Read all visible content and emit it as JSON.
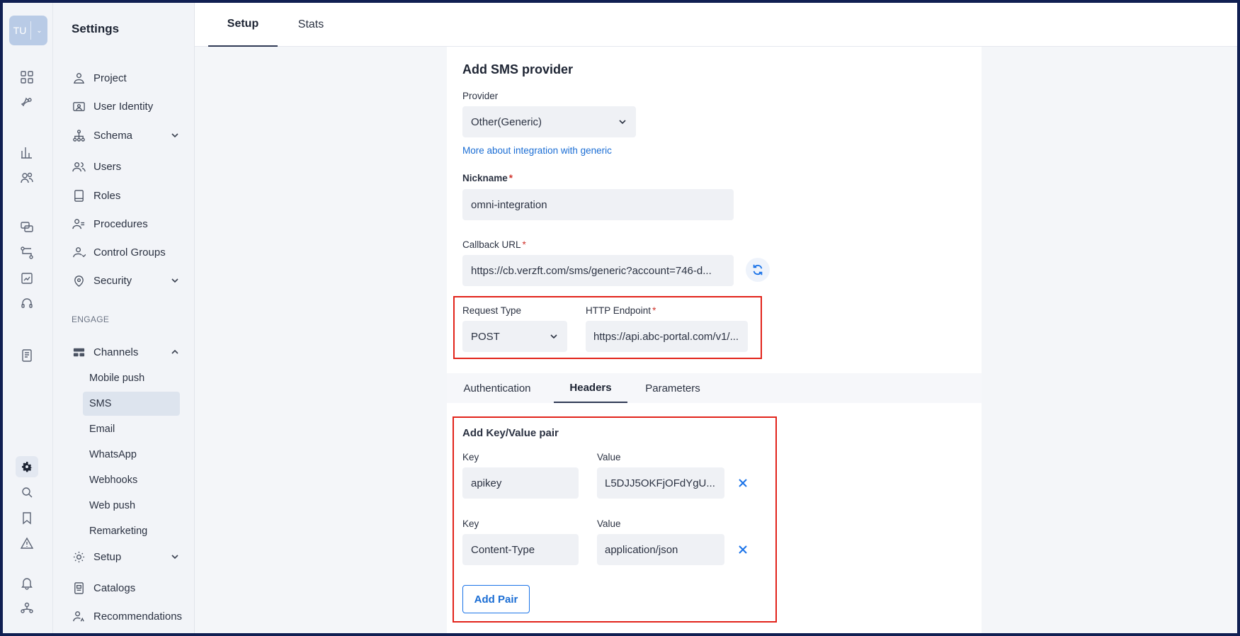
{
  "user": {
    "initials": "TU"
  },
  "rail": {
    "icons": [
      "dashboard-icon",
      "campaigns-icon",
      "analytics-icon",
      "segments-icon",
      "messages-icon",
      "flows-icon",
      "reports-icon",
      "support-icon",
      "templates-icon",
      "settings-icon",
      "search-settings-icon",
      "bookmark-icon",
      "alert-icon",
      "notifications-icon",
      "team-icon"
    ]
  },
  "nav": {
    "title": "Settings",
    "items": [
      {
        "label": "Project",
        "icon": "project-icon"
      },
      {
        "label": "User Identity",
        "icon": "user-identity-icon"
      },
      {
        "label": "Schema",
        "icon": "schema-icon",
        "expandable": true
      },
      {
        "label": "Users",
        "icon": "users-icon"
      },
      {
        "label": "Roles",
        "icon": "roles-icon"
      },
      {
        "label": "Procedures",
        "icon": "procedures-icon"
      },
      {
        "label": "Control Groups",
        "icon": "control-groups-icon"
      },
      {
        "label": "Security",
        "icon": "security-icon",
        "expandable": true
      }
    ],
    "section_label": "ENGAGE",
    "channels": {
      "label": "Channels",
      "items": [
        "Mobile push",
        "SMS",
        "Email",
        "WhatsApp",
        "Webhooks",
        "Web push",
        "Remarketing"
      ],
      "active": "SMS"
    },
    "bottom_items": [
      {
        "label": "Setup",
        "icon": "setup-icon",
        "expandable": true
      },
      {
        "label": "Catalogs",
        "icon": "catalogs-icon"
      },
      {
        "label": "Recommendations",
        "icon": "recommendations-icon"
      }
    ]
  },
  "top_tabs": {
    "setup": "Setup",
    "stats": "Stats",
    "active": "Setup"
  },
  "form": {
    "title": "Add SMS provider",
    "provider": {
      "label": "Provider",
      "value": "Other(Generic)"
    },
    "integration_link": "More about integration with generic",
    "nickname": {
      "label": "Nickname",
      "value": "omni-integration",
      "required": "*"
    },
    "callback_url": {
      "label": "Callback URL",
      "value": "https://cb.verzft.com/sms/generic?account=746-d...",
      "required": "*"
    },
    "request_type": {
      "label": "Request Type",
      "value": "POST"
    },
    "http_endpoint": {
      "label": "HTTP Endpoint",
      "value": "https://api.abc-portal.com/v1/...",
      "required": "*"
    }
  },
  "sub_tabs": {
    "authentication": "Authentication",
    "headers": "Headers",
    "parameters": "Parameters",
    "active": "Headers"
  },
  "headers": {
    "title": "Add Key/Value pair",
    "key_label": "Key",
    "value_label": "Value",
    "pairs": [
      {
        "key": "apikey",
        "value": "L5DJJ5OKFjOFdYgU..."
      },
      {
        "key": "Content-Type",
        "value": "application/json"
      }
    ],
    "add_button": "Add Pair"
  },
  "colors": {
    "accent": "#1a73e8",
    "highlight": "#e2231a",
    "required": "#d0332b"
  }
}
